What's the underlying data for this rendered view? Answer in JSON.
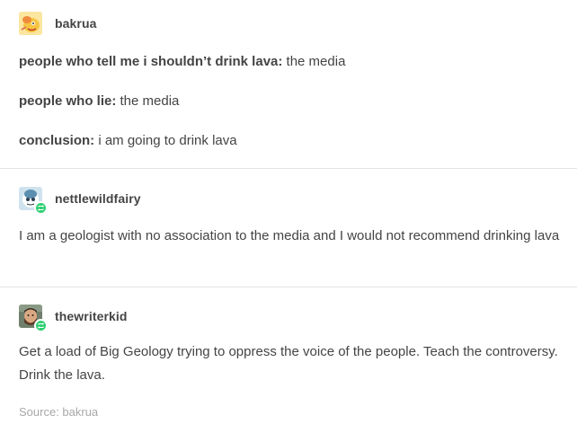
{
  "posts": [
    {
      "username": "bakrua",
      "lines": [
        {
          "bold": "people who tell me i shouldn’t drink lava:",
          "text": " the media"
        },
        {
          "bold": "people who lie:",
          "text": " the media"
        },
        {
          "bold": "conclusion:",
          "text": " i am going to drink lava"
        }
      ]
    },
    {
      "username": "nettlewildfairy",
      "body": "I am a geologist with no association to the media and I would not recommend drinking lava"
    },
    {
      "username": "thewriterkid",
      "body": "Get a load of Big Geology trying to oppress the voice of the people. Teach the controversy. Drink the lava."
    }
  ],
  "source": "Source: bakrua",
  "colors": {
    "text": "#444444",
    "muted": "#a8a8a8",
    "divider": "#e3e3e3",
    "reblog_badge": "#2fd072"
  },
  "icons": {
    "avatar_1": "cartoon-creature-avatar",
    "avatar_2": "blue-white-creature-avatar",
    "avatar_3": "bearded-man-avatar",
    "badge": "reblog-icon"
  }
}
